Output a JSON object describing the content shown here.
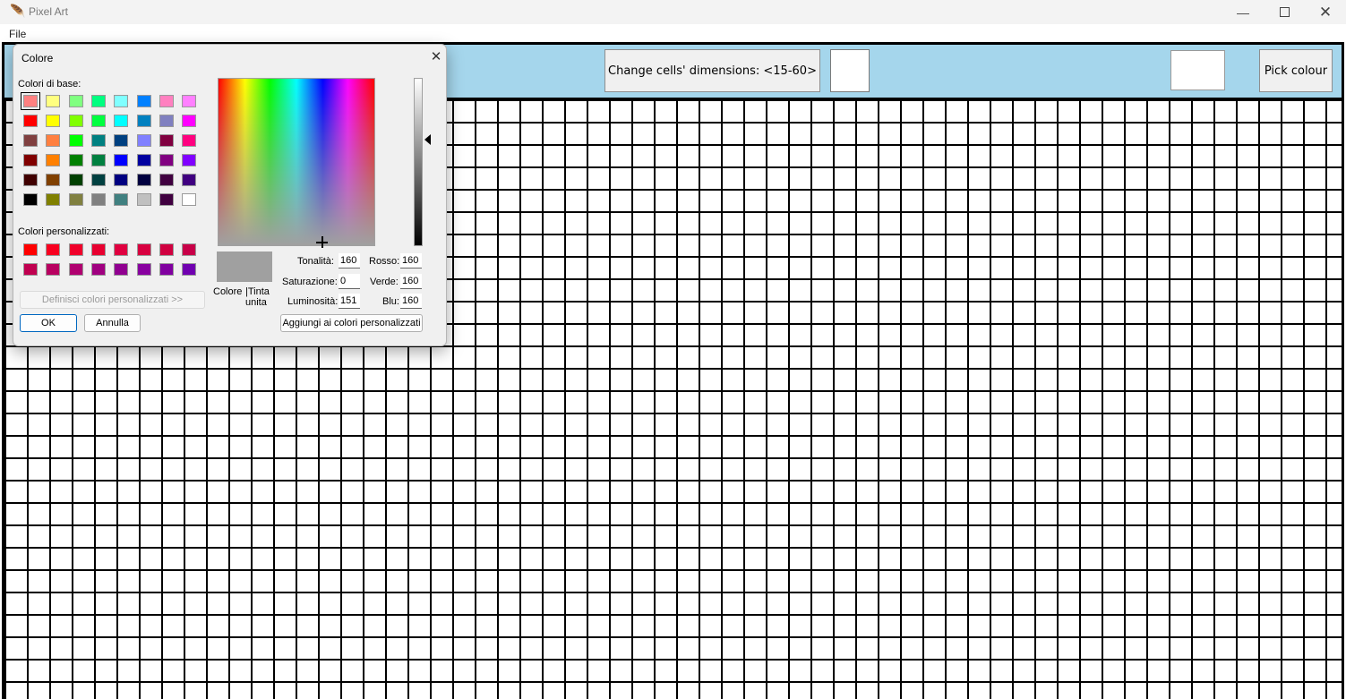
{
  "window": {
    "title": "Pixel Art",
    "minimize_icon": "minimize-icon",
    "maximize_icon": "maximize-icon",
    "close_icon": "close-icon",
    "app_icon": "feather-icon"
  },
  "menu": {
    "file": "File"
  },
  "toolbar": {
    "change_dimensions_label": "Change cells' dimensions: <15-60>",
    "dimension_value": "",
    "pick_colour_label": "Pick colour",
    "current_colour": "#ffffff"
  },
  "dialog": {
    "title": "Colore",
    "basic_colors_label": "Colori di base:",
    "custom_colors_label": "Colori personalizzati:",
    "define_custom_label": "Definisci colori personalizzati >>",
    "ok_label": "OK",
    "cancel_label": "Annulla",
    "add_custom_label": "Aggiungi ai colori personalizzati",
    "color_label": "Colore",
    "solid_label": "|Tinta unita",
    "hue_label": "Tonalità:",
    "sat_label": "Saturazione:",
    "lum_label": "Luminosità:",
    "red_label": "Rosso:",
    "green_label": "Verde:",
    "blue_label": "Blu:",
    "hue_value": "160",
    "sat_value": "0",
    "lum_value": "151",
    "red_value": "160",
    "green_value": "160",
    "blue_value": "160",
    "preview_color": "#a0a0a0",
    "basic_colors": [
      [
        "#ff8080",
        "#ffff80",
        "#80ff80",
        "#00ff80",
        "#80ffff",
        "#0080ff",
        "#ff80c0",
        "#ff80ff"
      ],
      [
        "#ff0000",
        "#ffff00",
        "#80ff00",
        "#00ff40",
        "#00ffff",
        "#0080c0",
        "#8080c0",
        "#ff00ff"
      ],
      [
        "#804040",
        "#ff8040",
        "#00ff00",
        "#008080",
        "#004080",
        "#8080ff",
        "#800040",
        "#ff0080"
      ],
      [
        "#800000",
        "#ff8000",
        "#008000",
        "#008040",
        "#0000ff",
        "#0000a0",
        "#800080",
        "#8000ff"
      ],
      [
        "#400000",
        "#804000",
        "#004000",
        "#004040",
        "#000080",
        "#000040",
        "#400040",
        "#400080"
      ],
      [
        "#000000",
        "#808000",
        "#808040",
        "#808080",
        "#408080",
        "#c0c0c0",
        "#400040",
        "#ffffff"
      ]
    ],
    "custom_colors": [
      [
        "#ff0000",
        "#f80020",
        "#f0002a",
        "#e80030",
        "#e00040",
        "#d80040",
        "#d00040",
        "#c80048"
      ],
      [
        "#c00050",
        "#b80060",
        "#b00070",
        "#a00080",
        "#900090",
        "#8800a0",
        "#8000a0",
        "#7000b0"
      ]
    ]
  }
}
